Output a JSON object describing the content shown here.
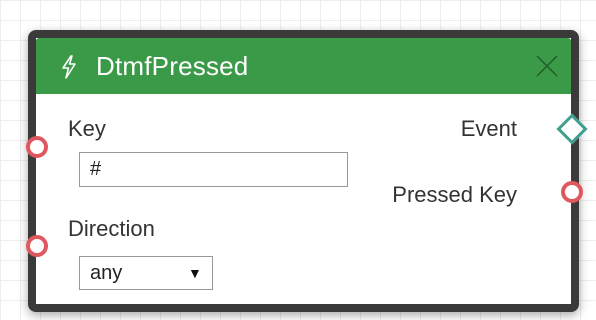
{
  "node": {
    "title": "DtmfPressed",
    "header_color": "#3a9a48",
    "icons": {
      "header": "bolt-icon",
      "close": "close-icon"
    }
  },
  "inputs": {
    "key": {
      "label": "Key",
      "value": "#"
    },
    "direction": {
      "label": "Direction",
      "selected": "any",
      "caret": "▼"
    }
  },
  "outputs": {
    "event": {
      "label": "Event",
      "port_color": "#3f9e8e"
    },
    "pressed_key": {
      "label": "Pressed Key",
      "port_color": "#e0585f"
    }
  }
}
